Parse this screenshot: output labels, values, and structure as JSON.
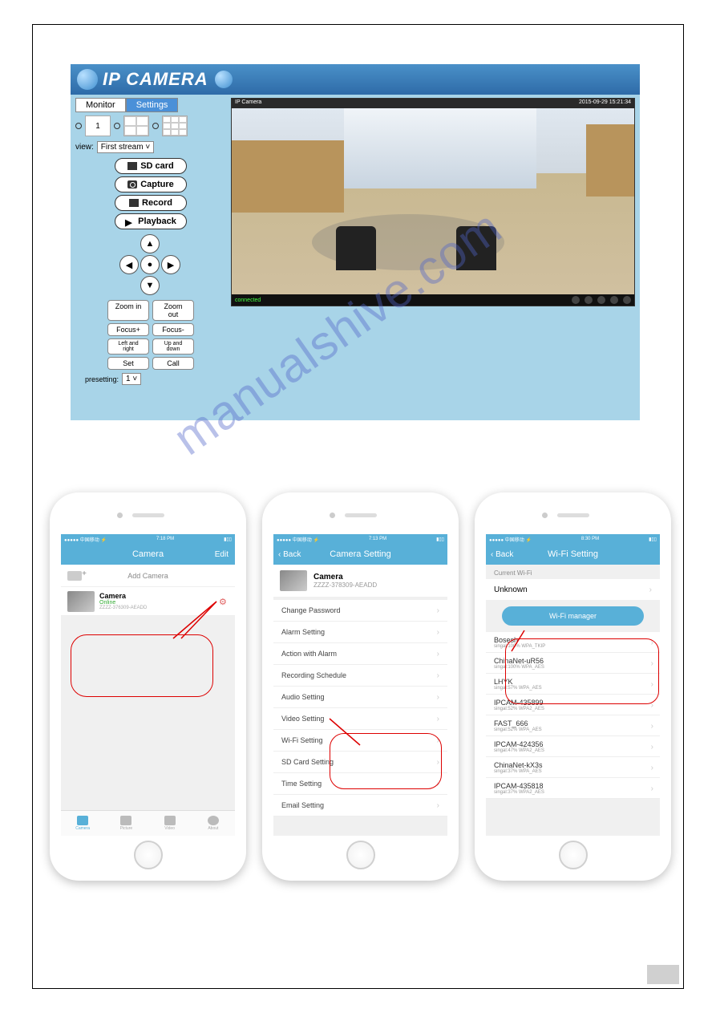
{
  "watermark": "manualshive.com",
  "desktop": {
    "title": "IP CAMERA",
    "tabs": {
      "monitor": "Monitor",
      "settings": "Settings"
    },
    "view_1": "1",
    "view_label": "view:",
    "view_select": "First stream",
    "buttons": {
      "sdcard": "SD card",
      "capture": "Capture",
      "record": "Record",
      "playback": "Playback"
    },
    "dpad": {
      "up": "▲",
      "down": "▼",
      "left": "◀",
      "right": "▶",
      "center": "●"
    },
    "controls": {
      "zoom_in": "Zoom in",
      "zoom_out": "Zoom out",
      "focus_plus": "Focus+",
      "focus_minus": "Focus-",
      "left_right": "Left and right",
      "up_down": "Up and down",
      "set": "Set",
      "call": "Call"
    },
    "preset_label": "presetting:",
    "preset_value": "1",
    "video": {
      "title": "IP Camera",
      "timestamp": "2015-09-29 15:21:34",
      "status": "connected"
    }
  },
  "phone1": {
    "status_left": "●●●●● 中国移动 ⚡",
    "status_time": "7:18 PM",
    "status_right": "▮▯▯",
    "nav_title": "Camera",
    "nav_right": "Edit",
    "add_camera": "Add Camera",
    "camera": {
      "name": "Camera",
      "status": "Online",
      "id": "ZZZZ-376309-AEADD"
    },
    "tabs": [
      "Camera",
      "Picture",
      "Video",
      "About"
    ]
  },
  "phone2": {
    "status_left": "●●●●● 中国移动 ⚡",
    "status_time": "7:13 PM",
    "status_right": "▮▯▯",
    "nav_back": "‹ Back",
    "nav_title": "Camera Setting",
    "camera": {
      "name": "Camera",
      "id": "ZZZZ-378309-AEADD"
    },
    "items": [
      "Change Password",
      "Alarm Setting",
      "Action with Alarm",
      "Recording Schedule",
      "Audio Setting",
      "Video Setting",
      "Wi-Fi Setting",
      "SD Card Setting",
      "Time Setting",
      "Email Setting"
    ]
  },
  "phone3": {
    "status_left": "●●●●● 中国移动 ⚡",
    "status_time": "8:30 PM",
    "status_right": "▮▯▯",
    "nav_back": "‹ Back",
    "nav_title": "Wi-Fi Setting",
    "current_label": "Current Wi-Fi",
    "current_value": "Unknown",
    "manager_btn": "Wi-Fi manager",
    "networks": [
      {
        "name": "Bosesh",
        "detail": "singal:100%      WPA_TKIP"
      },
      {
        "name": "ChinaNet-uR56",
        "detail": "singal:100%      WPA_AES"
      },
      {
        "name": "LHYK",
        "detail": "singal:57%      WPA_AES"
      },
      {
        "name": "IPCAM-435899",
        "detail": "singal:52%      WPA2_AES"
      },
      {
        "name": "FAST_666",
        "detail": "singal:52%      WPA_AES"
      },
      {
        "name": "IPCAM-424356",
        "detail": "singal:47%      WPA2_AES"
      },
      {
        "name": "ChinaNet-kX3s",
        "detail": "singal:37%      WPA_AES"
      },
      {
        "name": "IPCAM-435818",
        "detail": "singal:37%      WPA2_AES"
      }
    ]
  }
}
